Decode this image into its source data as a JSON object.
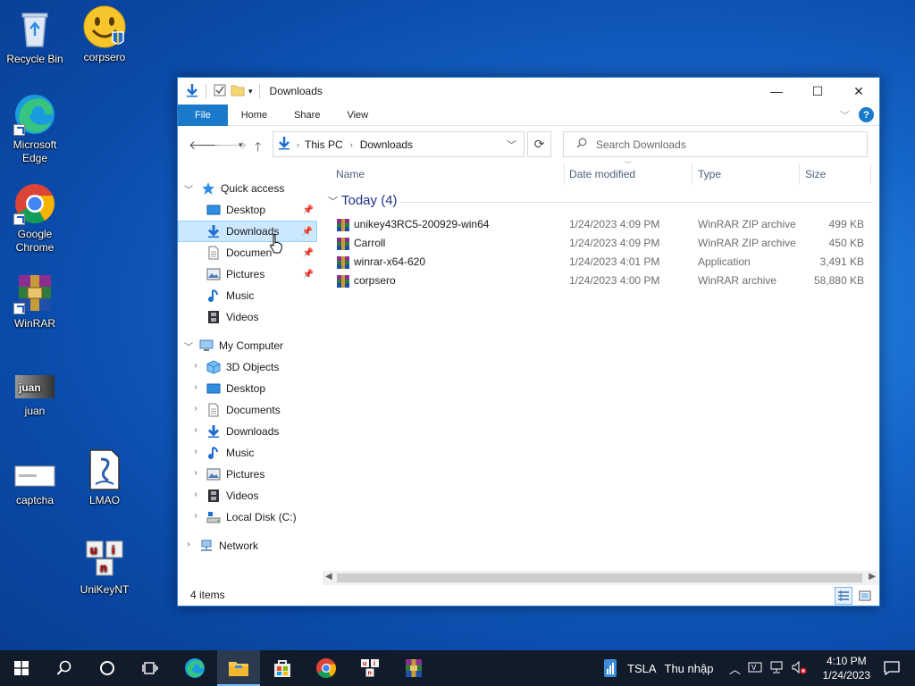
{
  "desktop": {
    "icons": [
      {
        "label": "Recycle Bin",
        "icon": "recycle-bin-icon"
      },
      {
        "label": "corpsero",
        "icon": "smiley-icon"
      },
      {
        "label": "Microsoft Edge",
        "icon": "edge-icon"
      },
      {
        "label": "Google Chrome",
        "icon": "chrome-icon"
      },
      {
        "label": "WinRAR",
        "icon": "winrar-icon"
      },
      {
        "label": "juan",
        "icon": "image-file-icon"
      },
      {
        "label": "captcha",
        "icon": "image-file-icon"
      },
      {
        "label": "LMAO",
        "icon": "text-file-icon"
      },
      {
        "label": "UniKeyNT",
        "icon": "unikey-icon"
      }
    ]
  },
  "window": {
    "title": "Downloads",
    "controls": {
      "minimize": "—",
      "maximize": "☐",
      "close": "✕"
    },
    "ribbon_tabs": [
      "File",
      "Home",
      "Share",
      "View"
    ],
    "address": {
      "parts": [
        "This PC",
        "Downloads"
      ]
    },
    "search": {
      "placeholder": "Search Downloads"
    },
    "nav": {
      "quick_access": "Quick access",
      "quick_items": [
        "Desktop",
        "Downloads",
        "Documen",
        "Pictures",
        "Music",
        "Videos"
      ],
      "my_computer": "My Computer",
      "computer_items": [
        "3D Objects",
        "Desktop",
        "Documents",
        "Downloads",
        "Music",
        "Pictures",
        "Videos",
        "Local Disk (C:)"
      ],
      "network": "Network"
    },
    "columns": [
      "Name",
      "Date modified",
      "Type",
      "Size"
    ],
    "group": "Today (4)",
    "files": [
      {
        "name": "unikey43RC5-200929-win64",
        "date": "1/24/2023 4:09 PM",
        "type": "WinRAR ZIP archive",
        "size": "499 KB"
      },
      {
        "name": "Carroll",
        "date": "1/24/2023 4:09 PM",
        "type": "WinRAR ZIP archive",
        "size": "450 KB"
      },
      {
        "name": "winrar-x64-620",
        "date": "1/24/2023 4:01 PM",
        "type": "Application",
        "size": "3,491 KB"
      },
      {
        "name": "corpsero",
        "date": "1/24/2023 4:00 PM",
        "type": "WinRAR archive",
        "size": "58,880 KB"
      }
    ],
    "status": "4 items"
  },
  "taskbar": {
    "stock": "TSLA",
    "stock_label": "Thu nhập",
    "time": "4:10 PM",
    "date": "1/24/2023"
  },
  "colors": {
    "accent": "#1979ca",
    "selection": "#cce8ff",
    "taskbar": "#121b2a"
  }
}
